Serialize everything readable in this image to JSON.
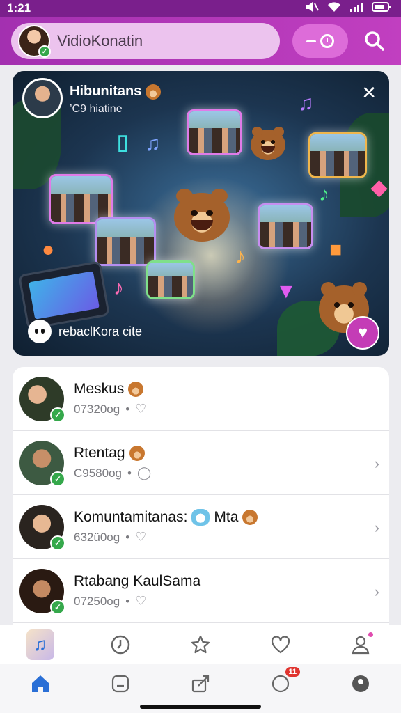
{
  "status": {
    "time": "1:21"
  },
  "header": {
    "title": "VidioKonatin"
  },
  "hero": {
    "name": "Hibunitans",
    "subtitle": "’C9 hiatine",
    "caption": "rebaclKora cite"
  },
  "list": [
    {
      "title": "Meskus",
      "sub": "07320og",
      "emoji": "bear",
      "chevron": false
    },
    {
      "title": "Rtentag",
      "sub": "C9580og",
      "emoji": "bear",
      "chevron": true
    },
    {
      "title": "Komuntamitanas:",
      "title_extra": "Mta",
      "sub": "632ü0og",
      "emoji": "cat-bear",
      "chevron": true
    },
    {
      "title": "Rtabang KaulSama",
      "sub": "07250og",
      "emoji": "none",
      "chevron": true
    }
  ],
  "tabbar_top": [
    "music-app",
    "clock",
    "star",
    "heart",
    "profile"
  ],
  "tabbar_bottom": {
    "icons": [
      "home",
      "message",
      "share",
      "notifications",
      "location"
    ],
    "notification_badge": "11"
  },
  "colors": {
    "header": "#b236b8",
    "accent": "#c43cb6",
    "verify": "#35a84b",
    "nav_active": "#2a6fd6"
  }
}
